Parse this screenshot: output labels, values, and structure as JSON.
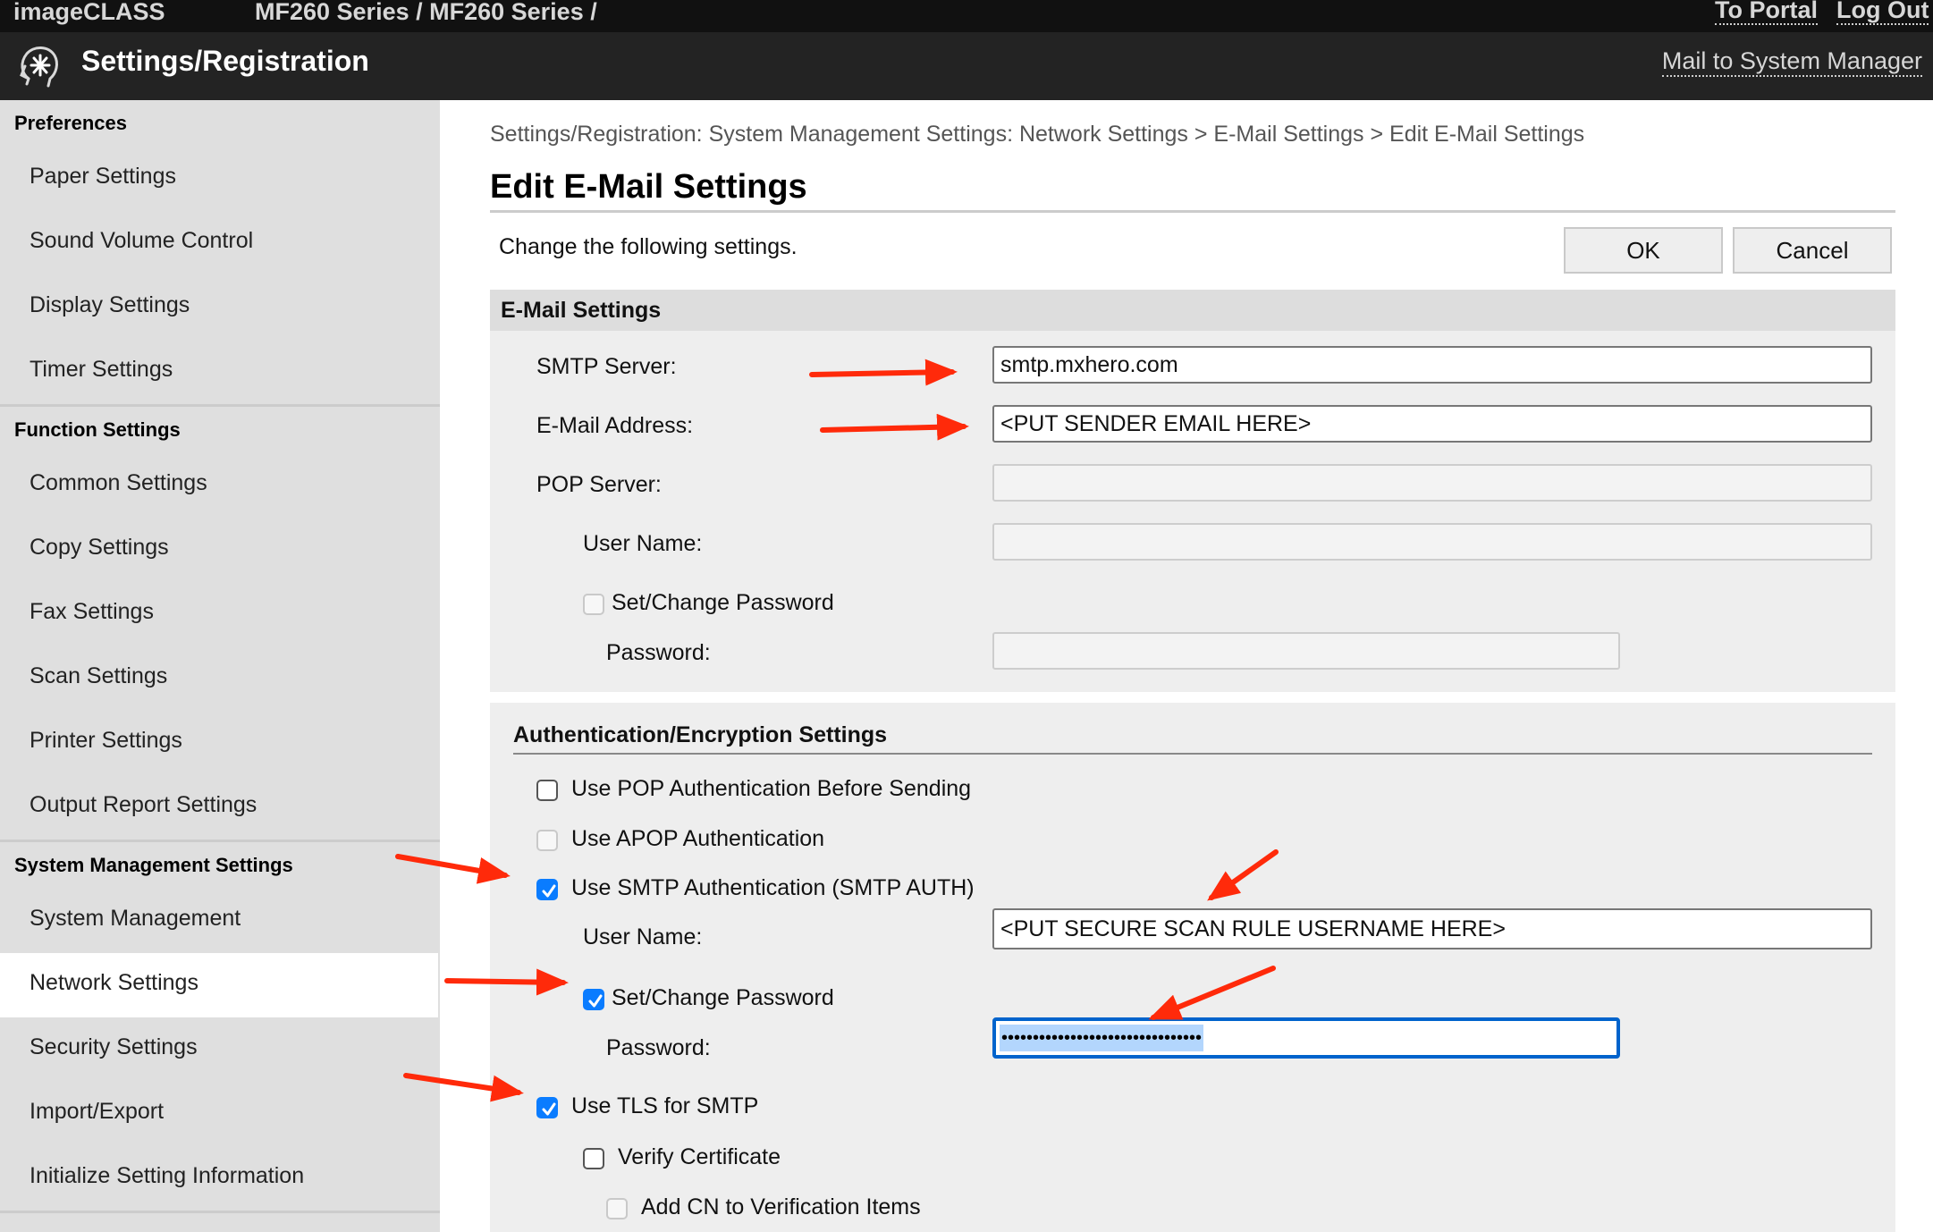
{
  "topbar": {
    "brand": "imageCLASS",
    "series": "MF260 Series / MF260 Series /",
    "to_portal": "To Portal",
    "log_out": "Log Out"
  },
  "titlebar": {
    "title": "Settings/Registration",
    "mail_link": "Mail to System Manager",
    "logo_icon": "settings-head-icon"
  },
  "sidebar": {
    "groups": [
      {
        "heading": "Preferences",
        "items": [
          "Paper Settings",
          "Sound Volume Control",
          "Display Settings",
          "Timer Settings"
        ]
      },
      {
        "heading": "Function Settings",
        "items": [
          "Common Settings",
          "Copy Settings",
          "Fax Settings",
          "Scan Settings",
          "Printer Settings",
          "Output Report Settings"
        ]
      },
      {
        "heading": "System Management Settings",
        "items": [
          "System Management",
          "Network Settings",
          "Security Settings",
          "Import/Export",
          "Initialize Setting Information"
        ]
      }
    ],
    "active_item": "Network Settings"
  },
  "main": {
    "breadcrumb": "Settings/Registration: System Management Settings: Network Settings > E-Mail Settings > Edit E-Mail Settings",
    "title": "Edit E-Mail Settings",
    "intro": "Change the following settings.",
    "ok_label": "OK",
    "cancel_label": "Cancel"
  },
  "email_settings": {
    "heading": "E-Mail Settings",
    "smtp_server_label": "SMTP Server:",
    "smtp_server_value": "smtp.mxhero.com",
    "email_address_label": "E-Mail Address:",
    "email_address_value": "<PUT SENDER EMAIL HERE>",
    "pop_server_label": "POP Server:",
    "pop_server_value": "",
    "user_name_label": "User Name:",
    "user_name_value": "",
    "set_change_password_label": "Set/Change Password",
    "set_change_password_checked": false,
    "password_label": "Password:",
    "password_value": ""
  },
  "auth_settings": {
    "heading": "Authentication/Encryption Settings",
    "pop_before_smtp_label": "Use POP Authentication Before Sending",
    "pop_before_smtp_checked": false,
    "apop_label": "Use APOP Authentication",
    "apop_checked": false,
    "smtp_auth_label": "Use SMTP Authentication (SMTP AUTH)",
    "smtp_auth_checked": true,
    "user_name_label": "User Name:",
    "user_name_value": "<PUT SECURE SCAN RULE USERNAME HERE>",
    "set_change_password_label": "Set/Change Password",
    "set_change_password_checked": true,
    "password_label": "Password:",
    "password_masked": "••••••••••••••••••••••••••••••••",
    "tls_label": "Use TLS for SMTP",
    "tls_checked": true,
    "verify_cert_label": "Verify Certificate",
    "verify_cert_checked": false,
    "add_cn_label": "Add CN to Verification Items",
    "add_cn_checked": false
  },
  "colors": {
    "annotation_arrow": "#ff2a0a",
    "checkbox_checked": "#0a7cff",
    "focus_ring": "#0063cc",
    "selection": "#b3d6fd"
  }
}
